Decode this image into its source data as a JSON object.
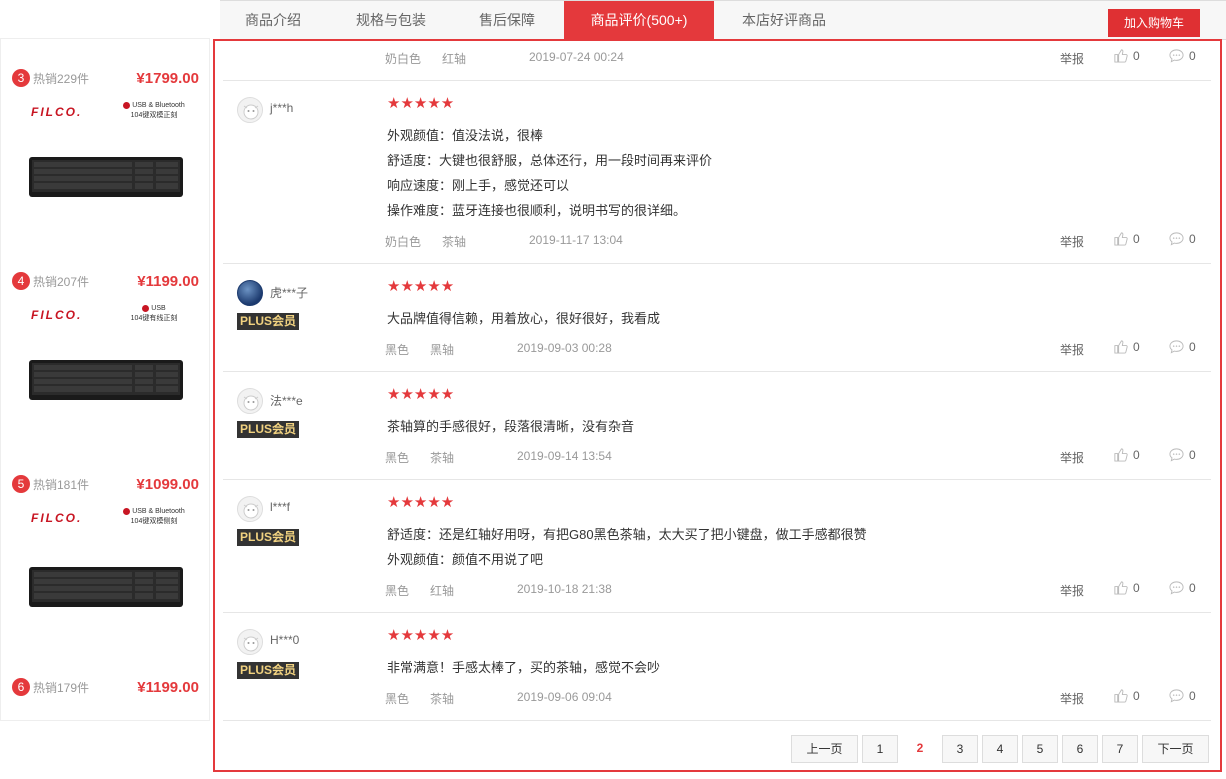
{
  "tabs": [
    "商品介绍",
    "规格与包装",
    "售后保障",
    "商品评价(500+)",
    "本店好评商品"
  ],
  "cart_button": "加入购物车",
  "sidebar": [
    {
      "rank": "3",
      "hot": "热销229件",
      "price": "¥1799.00",
      "brand": "FILCO.",
      "conn1": "USB & Bluetooth",
      "conn2": "104键双模正刻"
    },
    {
      "rank": "4",
      "hot": "热销207件",
      "price": "¥1199.00",
      "brand": "FILCO.",
      "conn1": "USB",
      "conn2": "104键有线正刻"
    },
    {
      "rank": "5",
      "hot": "热销181件",
      "price": "¥1099.00",
      "brand": "FILCO.",
      "conn1": "USB & Bluetooth",
      "conn2": "104键双模侧刻"
    },
    {
      "rank": "6",
      "hot": "热销179件",
      "price": "¥1199.00"
    }
  ],
  "top_meta": {
    "color": "奶白色",
    "switch": "红轴",
    "time": "2019-07-24 00:24",
    "report": "举报",
    "likes": "0",
    "comments": "0"
  },
  "reviews": [
    {
      "user": "j***h",
      "plus": "",
      "lines": [
        "外观颜值：值没法说，很棒",
        "舒适度：大键也很舒服，总体还行，用一段时间再来评价",
        "响应速度：刚上手，感觉还可以",
        "操作难度：蓝牙连接也很顺利，说明书写的很详细。"
      ],
      "color": "奶白色",
      "switch": "茶轴",
      "time": "2019-11-17 13:04",
      "report": "举报",
      "likes": "0",
      "comments": "0"
    },
    {
      "user": "虎***子",
      "plus": "PLUS会员",
      "lines": [
        "大品牌值得信赖，用着放心，很好很好，我看成"
      ],
      "color": "黑色",
      "switch": "黑轴",
      "time": "2019-09-03 00:28",
      "report": "举报",
      "likes": "0",
      "comments": "0"
    },
    {
      "user": "法***e",
      "plus": "PLUS会员",
      "lines": [
        "茶轴算的手感很好，段落很清晰，没有杂音"
      ],
      "color": "黑色",
      "switch": "茶轴",
      "time": "2019-09-14 13:54",
      "report": "举报",
      "likes": "0",
      "comments": "0"
    },
    {
      "user": "l***f",
      "plus": "PLUS会员",
      "lines": [
        "舒适度：还是红轴好用呀，有把G80黑色茶轴，太大买了把小键盘，做工手感都很赞",
        "外观颜值：颜值不用说了吧"
      ],
      "color": "黑色",
      "switch": "红轴",
      "time": "2019-10-18 21:38",
      "report": "举报",
      "likes": "0",
      "comments": "0"
    },
    {
      "user": "H***0",
      "plus": "PLUS会员",
      "lines": [
        "非常满意！手感太棒了，买的茶轴，感觉不会吵"
      ],
      "color": "黑色",
      "switch": "茶轴",
      "time": "2019-09-06 09:04",
      "report": "举报",
      "likes": "0",
      "comments": "0"
    }
  ],
  "stars": "★★★★★",
  "pager": {
    "prev": "上一页",
    "pages": [
      "1",
      "2",
      "3",
      "4",
      "5",
      "6",
      "7"
    ],
    "current": "2",
    "next": "下一页"
  }
}
